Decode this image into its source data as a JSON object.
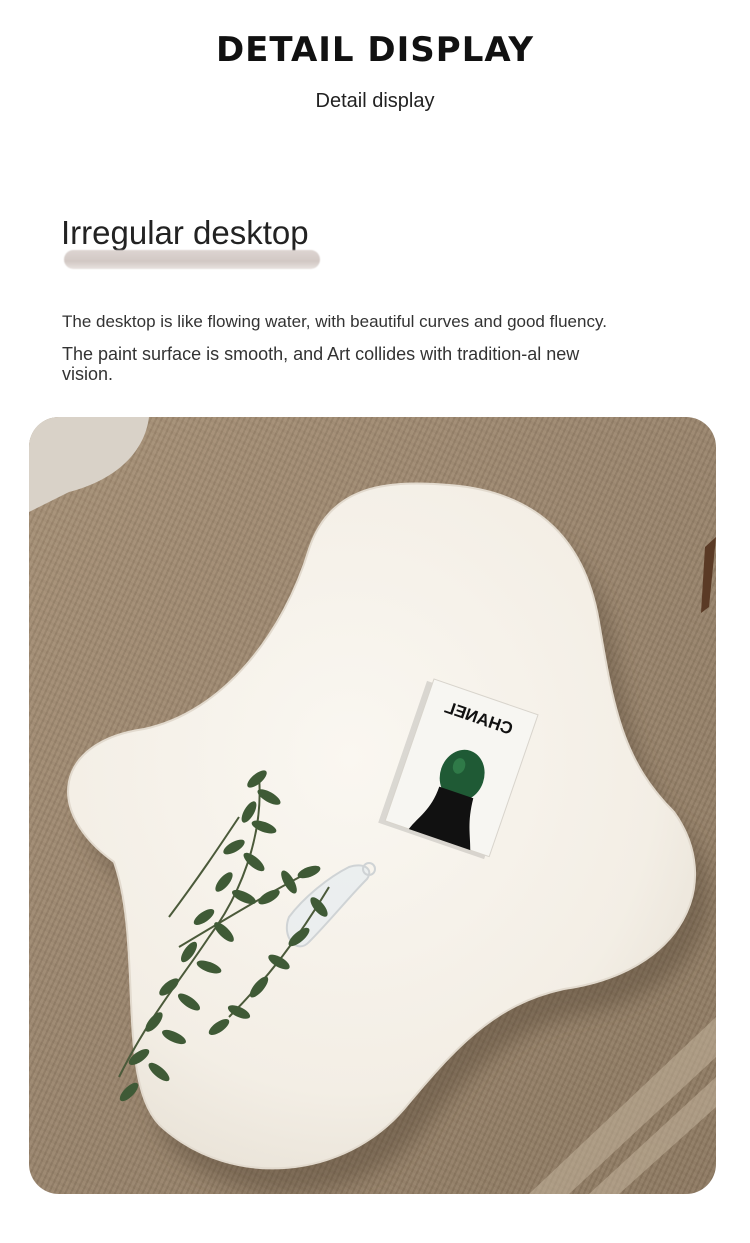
{
  "header": {
    "title": "DETAIL DISPLAY",
    "subtitle": "Detail display"
  },
  "section": {
    "heading": "Irregular desktop",
    "description_1": "The desktop is like flowing water, with beautiful curves and good fluency.",
    "description_2": "The paint surface is smooth, and Art collides with tradition-al new vision."
  },
  "photo": {
    "book_title": "CHANEL",
    "colors": {
      "tabletop": "#f4efe6",
      "rug": "#9d8870",
      "leaf_green": "#3f5a36"
    },
    "icons": [
      "table-photo"
    ]
  }
}
